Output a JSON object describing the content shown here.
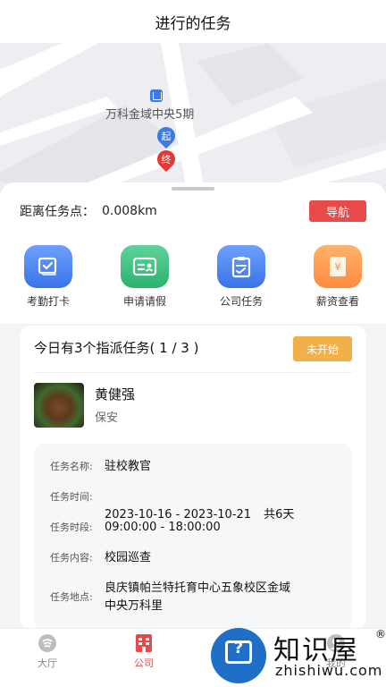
{
  "header": {
    "title": "进行的任务"
  },
  "map": {
    "place_label": "万科金域中央5期",
    "start_marker": "起",
    "end_marker": "终"
  },
  "distance": {
    "label": "距离任务点：",
    "value": "0.008km",
    "nav_button": "导航"
  },
  "shortcuts": [
    {
      "label": "考勤打卡",
      "icon": "checkin-icon"
    },
    {
      "label": "申请请假",
      "icon": "leave-request-icon"
    },
    {
      "label": "公司任务",
      "icon": "clipboard-icon"
    },
    {
      "label": "薪资查看",
      "icon": "salary-icon"
    }
  ],
  "task_card": {
    "title": "今日有3个指派任务( 1 / 3 )",
    "status": "未开始",
    "person_name": "黄健强",
    "person_role": "保安",
    "details": [
      {
        "key": "任务名称:",
        "value": "驻校教官"
      },
      {
        "key": "任务时间:",
        "value": "2023-10-16 - 2023-10-21",
        "extra": "共6天"
      },
      {
        "key": "任务时段:",
        "value": "09:00:00 - 18:00:00"
      },
      {
        "key": "任务内容:",
        "value": "校园巡查"
      },
      {
        "key": "任务地点:",
        "value": "良庆镇帕兰特托育中心五象校区金域\n中央万科里"
      }
    ]
  },
  "tabbar": {
    "home": "大厅",
    "company": "公司",
    "mine": "我的"
  },
  "watermark": {
    "cn": "知识屋",
    "en": "zhishiwu.com",
    "reg": "®",
    "glyph": "?"
  },
  "colors": {
    "accent_red": "#e84a4a",
    "status_orange": "#f0b14a",
    "blue": "#3a73e6",
    "green": "#2bb36f",
    "orange": "#ff8a3d"
  }
}
